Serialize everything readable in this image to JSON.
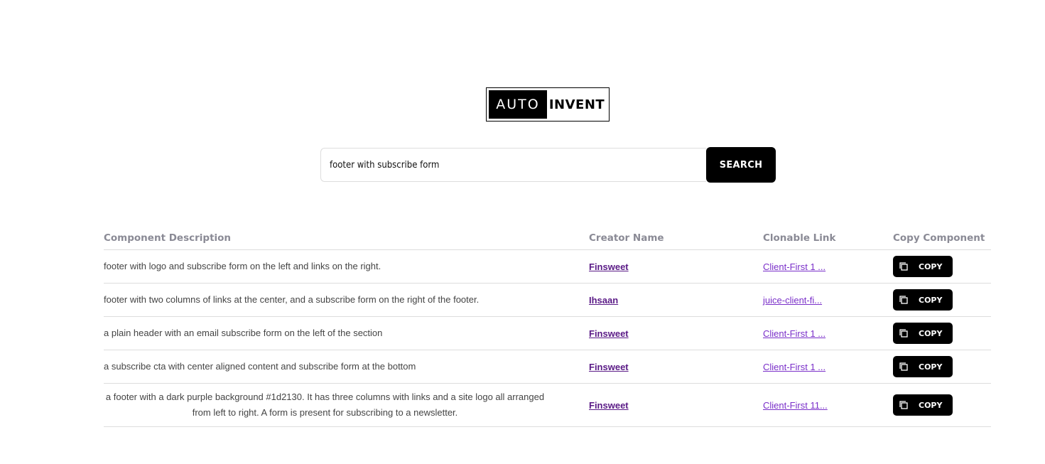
{
  "logo": {
    "left_text": "AUTO",
    "right_text": "INVENT"
  },
  "search": {
    "value": "footer with subscribe form",
    "button_label": "SEARCH"
  },
  "table": {
    "headers": {
      "description": "Component Description",
      "creator": "Creator Name",
      "link": "Clonable Link",
      "copy": "Copy Component"
    },
    "rows": [
      {
        "description": "footer with logo and subscribe form on the left and links on the right.",
        "creator": "Finsweet",
        "link": "Client-First 1 ...",
        "copy_label": "COPY"
      },
      {
        "description": "footer with two columns of links at the center, and a subscribe form on the right of the footer.",
        "creator": "Ihsaan",
        "link": "juice-client-fi...",
        "copy_label": "COPY"
      },
      {
        "description": "a plain header with an email subscribe form on the left of the section",
        "creator": "Finsweet",
        "link": "Client-First 1 ...",
        "copy_label": "COPY"
      },
      {
        "description": "a subscribe cta with center aligned content and subscribe form at the bottom",
        "creator": "Finsweet",
        "link": "Client-First 1 ...",
        "copy_label": "COPY"
      },
      {
        "description": "a footer with a dark purple background #1d2130. It has three columns with links and a site logo all arranged from left to right. A form is present for subscribing to a newsletter.",
        "creator": "Finsweet",
        "link": "Client-First 11...",
        "copy_label": "COPY"
      }
    ]
  },
  "colors": {
    "creator_link": "#5a1a86",
    "clone_link": "#7a2fc9",
    "button_bg": "#000000",
    "header_text": "#8a8a95"
  },
  "icons": {
    "copy": "copy-icon"
  }
}
